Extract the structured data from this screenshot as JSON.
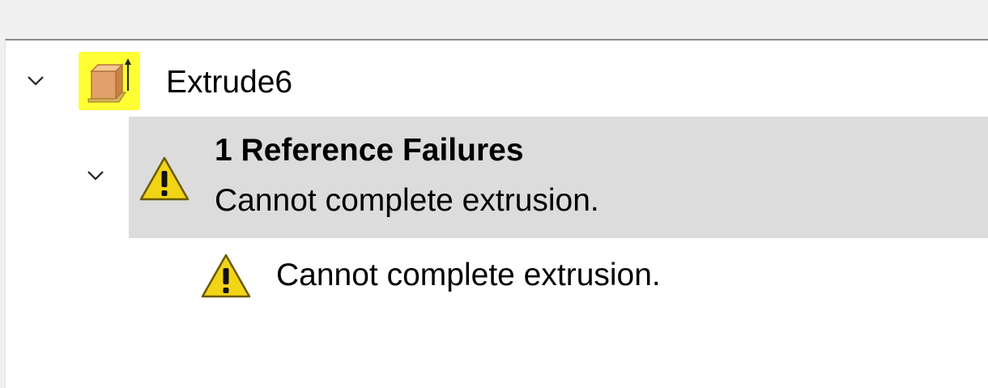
{
  "tree": {
    "feature": {
      "label": "Extrude6",
      "icon": "extrude-feature-icon",
      "expanded": true,
      "highlight_color": "#ffff33"
    },
    "failure_group": {
      "title": "1 Reference Failures",
      "message": "Cannot complete extrusion.",
      "icon": "warning-icon",
      "expanded": true,
      "selected": true
    },
    "failure_items": [
      {
        "message": "Cannot complete extrusion.",
        "icon": "warning-icon"
      }
    ]
  },
  "colors": {
    "selection_bg": "#dcdcdc",
    "warning_fill": "#f2d416",
    "panel_bg": "#ffffff"
  }
}
